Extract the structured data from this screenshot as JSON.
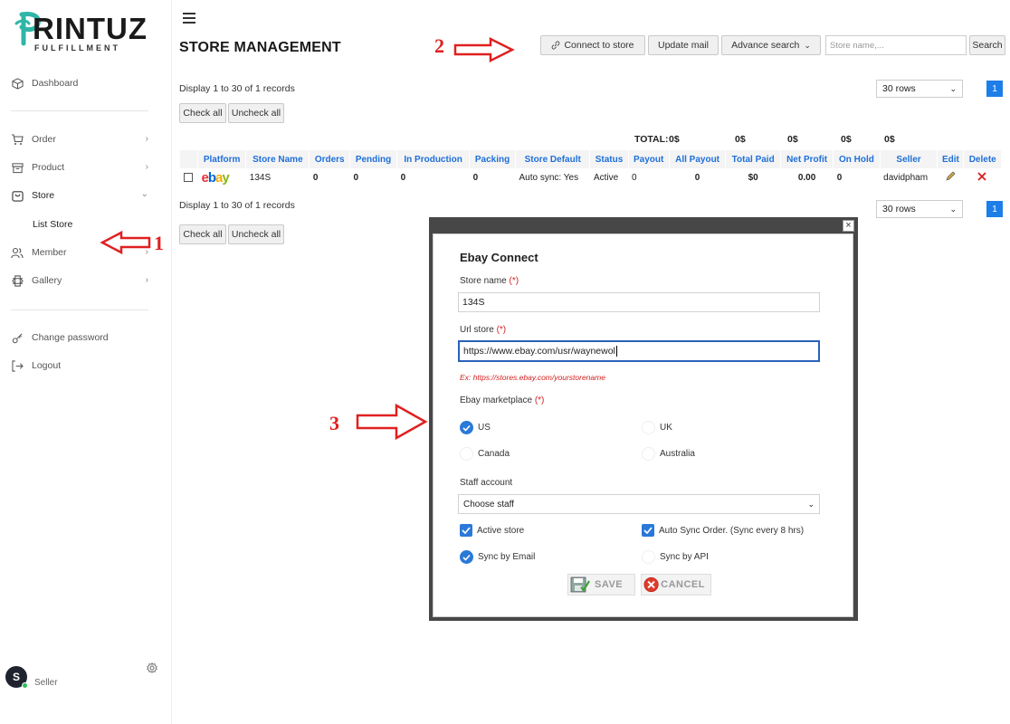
{
  "app": {
    "logo_text": "RINTUZ",
    "logo_letter": "P",
    "logo_sub": "FULFILLMENT"
  },
  "sidebar": {
    "items": [
      {
        "label": "Dashboard",
        "icon": "cube-icon"
      },
      {
        "label": "Order",
        "icon": "cart-icon"
      },
      {
        "label": "Product",
        "icon": "box-icon"
      },
      {
        "label": "Store",
        "icon": "bag-icon"
      },
      {
        "label": "Member",
        "icon": "users-icon"
      },
      {
        "label": "Gallery",
        "icon": "gallery-icon"
      },
      {
        "label": "Change password",
        "icon": "key-icon"
      },
      {
        "label": "Logout",
        "icon": "logout-icon"
      }
    ],
    "sub_items": [
      {
        "label": "List Store"
      }
    ],
    "user": {
      "initial": "S",
      "role": "Seller"
    }
  },
  "header": {
    "title": "STORE MANAGEMENT",
    "connect_label": "Connect to store",
    "update_mail_label": "Update mail",
    "advance_search_label": "Advance search",
    "search_placeholder": "Store name,...",
    "search_label": "Search"
  },
  "listing": {
    "display_text": "Display 1 to 30 of 1 records",
    "check_all": "Check all",
    "uncheck_all": "Uncheck all",
    "rows_option": "30 rows",
    "page": "1"
  },
  "totals": {
    "label": "TOTAL:",
    "payout": "0$",
    "all_payout": "0$",
    "total_paid": "0$",
    "net_profit": "0$",
    "on_hold": "0$"
  },
  "table": {
    "headers": [
      "Platform",
      "Store Name",
      "Orders",
      "Pending",
      "In Production",
      "Packing",
      "Store Default",
      "Status",
      "Payout",
      "All Payout",
      "Total Paid",
      "Net Profit",
      "On Hold",
      "Seller",
      "Edit",
      "Delete"
    ],
    "rows": [
      {
        "platform": "ebay",
        "store_name": "134S",
        "orders": "0",
        "pending": "0",
        "in_production": "0",
        "packing": "0",
        "store_default": "Auto sync: Yes",
        "status": "Active",
        "payout": "0",
        "all_payout": "0",
        "total_paid": "$0",
        "net_profit": "0.00",
        "on_hold": "0",
        "seller": "davidpham"
      }
    ]
  },
  "annotations": {
    "one": "1",
    "two": "2",
    "three": "3"
  },
  "modal": {
    "title": "Ebay Connect",
    "close": "×",
    "store_name_label": "Store name",
    "store_name_value": "134S",
    "url_label": "Url store",
    "url_value": "https://www.ebay.com/usr/waynewol",
    "required_mark": "(*)",
    "url_hint": "Ex: https://stores.ebay.com/yourstorename",
    "marketplace_label": "Ebay marketplace",
    "marketplaces": [
      {
        "label": "US",
        "selected": true
      },
      {
        "label": "UK",
        "selected": false
      },
      {
        "label": "Canada",
        "selected": false
      },
      {
        "label": "Australia",
        "selected": false
      }
    ],
    "staff_label": "Staff account",
    "staff_value": "Choose staff",
    "active_store_label": "Active store",
    "auto_sync_label": "Auto Sync Order. (Sync every 8 hrs)",
    "sync_email_label": "Sync by Email",
    "sync_api_label": "Sync by API",
    "save_label": "SAVE",
    "cancel_label": "CANCEL"
  },
  "colors": {
    "accent": "#1e7ee8",
    "header_text": "#1e6fd9",
    "danger": "#d32020",
    "checkbox": "#2a79d8"
  }
}
